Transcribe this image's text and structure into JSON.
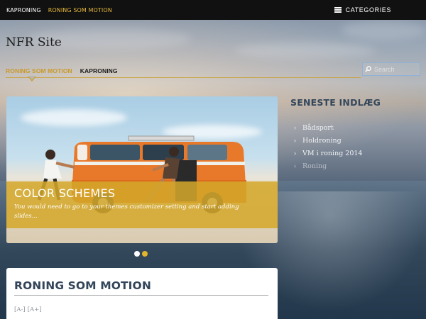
{
  "topbar": {
    "nav": [
      {
        "label": "KAPRONING",
        "active": false
      },
      {
        "label": "RONING SOM MOTION",
        "active": true
      }
    ],
    "categories_label": "CATEGORIES",
    "categories_icon": "hamburger-menu-icon",
    "active_color": "#e8b93a"
  },
  "site": {
    "title": "NFR Site"
  },
  "secondary_nav": [
    {
      "label": "RONING SOM MOTION",
      "active": true
    },
    {
      "label": "KAPRONING",
      "active": false
    }
  ],
  "search": {
    "placeholder": "Search",
    "icon": "search-icon"
  },
  "slider": {
    "title": "COLOR SCHEMES",
    "text": "You would need to go to your themes customizer setting and start adding slides...",
    "slide_count": 2,
    "active_slide": 2,
    "caption_color": "#d4a82a"
  },
  "sidebar": {
    "title": "SENESTE INDLÆG",
    "items": [
      {
        "label": "Bådsport",
        "dim": false
      },
      {
        "label": "Holdroning",
        "dim": false
      },
      {
        "label": "VM i roning 2014",
        "dim": false
      },
      {
        "label": "Roning",
        "dim": true
      }
    ],
    "item_icon": "chevron-right-icon"
  },
  "content": {
    "title": "RONING SOM MOTION",
    "font_decrease": "[A-]",
    "font_increase": "[A+]"
  }
}
